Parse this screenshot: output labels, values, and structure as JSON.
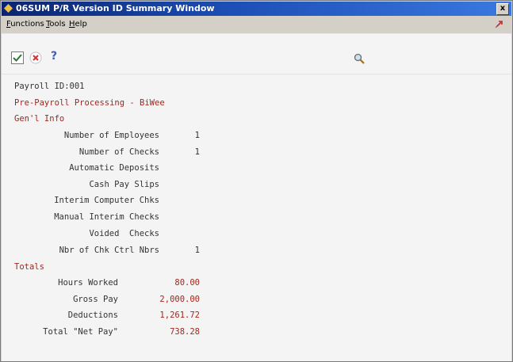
{
  "window": {
    "title": "06SUM P/R Version ID Summary Window",
    "close_label": "x"
  },
  "menu": {
    "items": [
      "Functions",
      "Tools",
      "Help"
    ]
  },
  "toolbar": {
    "ok_icon": "check-icon",
    "cancel_icon": "cancel-icon",
    "help_label": "?",
    "search_icon": "magnifier-icon"
  },
  "header": {
    "payroll_id": "Payroll ID:001",
    "process_title": "Pre-Payroll Processing - BiWee",
    "section_general": "Gen'l Info",
    "section_totals": "Totals"
  },
  "general": [
    {
      "label": "Number of Employees",
      "value": "1"
    },
    {
      "label": "Number of Checks",
      "value": "1"
    },
    {
      "label": "Automatic Deposits",
      "value": ""
    },
    {
      "label": "Cash Pay Slips",
      "value": ""
    },
    {
      "label": "Interim Computer Chks",
      "value": ""
    },
    {
      "label": "Manual Interim Checks",
      "value": ""
    },
    {
      "label": "Voided  Checks",
      "value": ""
    },
    {
      "label": "Nbr of Chk Ctrl Nbrs",
      "value": "1"
    }
  ],
  "totals": [
    {
      "label": "Hours Worked",
      "value": "80.00"
    },
    {
      "label": "Gross Pay",
      "value": "2,000.00"
    },
    {
      "label": "Deductions",
      "value": "1,261.72"
    },
    {
      "label": "Total \"Net Pay\"",
      "value": "738.28"
    }
  ],
  "colors": {
    "title_gradient_start": "#0a2470",
    "label_text": "#333333",
    "value_red": "#a0281e"
  }
}
